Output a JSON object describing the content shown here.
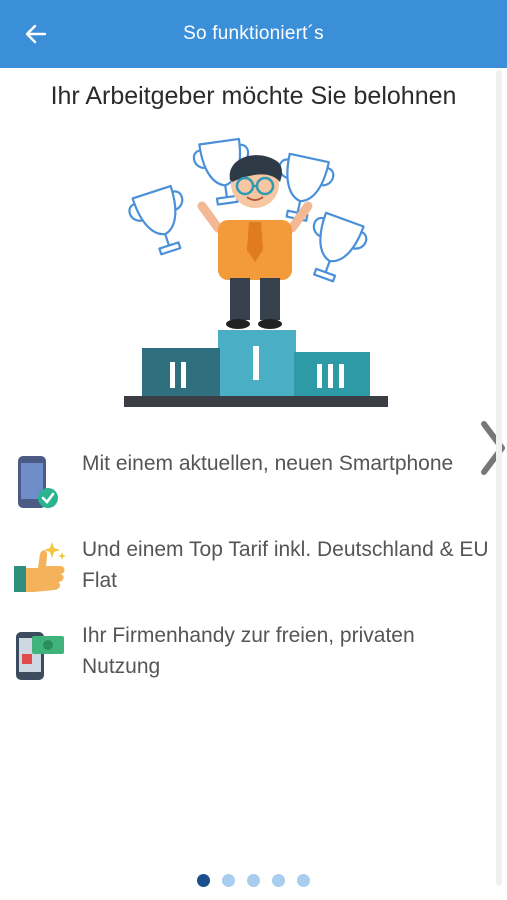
{
  "header": {
    "title": "So funktioniert´s",
    "back_icon": "arrow-left-icon"
  },
  "page": {
    "title": "Ihr Arbeitgeber möchte Sie belohnen"
  },
  "hero": {
    "icon": "winner-podium-illustration",
    "podium_labels": [
      "II",
      "I",
      "III"
    ]
  },
  "features": [
    {
      "icon": "smartphone-check-icon",
      "text": "Mit einem aktuellen, neuen Smartphone"
    },
    {
      "icon": "thumbs-up-icon",
      "text": "Und einem Top Tarif inkl. Deutschland & EU Flat"
    },
    {
      "icon": "phone-money-icon",
      "text": "Ihr Firmenhandy zur freien, privaten Nutzung"
    }
  ],
  "pagination": {
    "total": 5,
    "active": 1
  },
  "colors": {
    "appbar": "#3b8fd9",
    "dot_active": "#1a4f8e",
    "dot_inactive": "#a8cdef"
  }
}
